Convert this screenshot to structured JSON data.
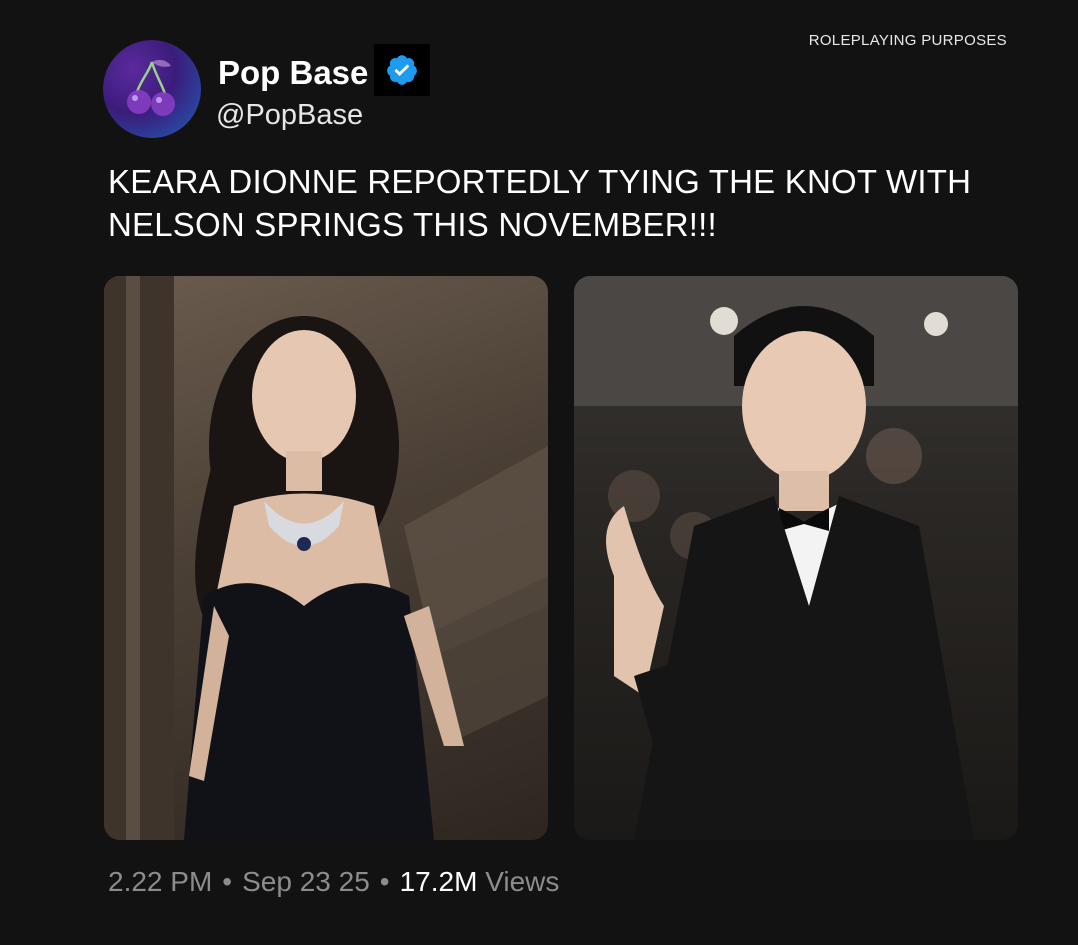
{
  "corner_note": "ROLEPLAYING PURPOSES",
  "account": {
    "display_name": "Pop Base",
    "handle": "@PopBase",
    "avatar_icon": "cherry-icon",
    "verified_icon": "verified-badge-icon",
    "verified_color": "#1d9bf0"
  },
  "tweet": {
    "text": "KEARA DIONNE REPORTEDLY TYING THE KNOT WITH NELSON SPRINGS THIS NOVEMBER!!!"
  },
  "meta": {
    "time": "2.22 PM",
    "separator": "•",
    "date": "Sep 23 25",
    "views_count": "17.2M",
    "views_label": "Views"
  }
}
